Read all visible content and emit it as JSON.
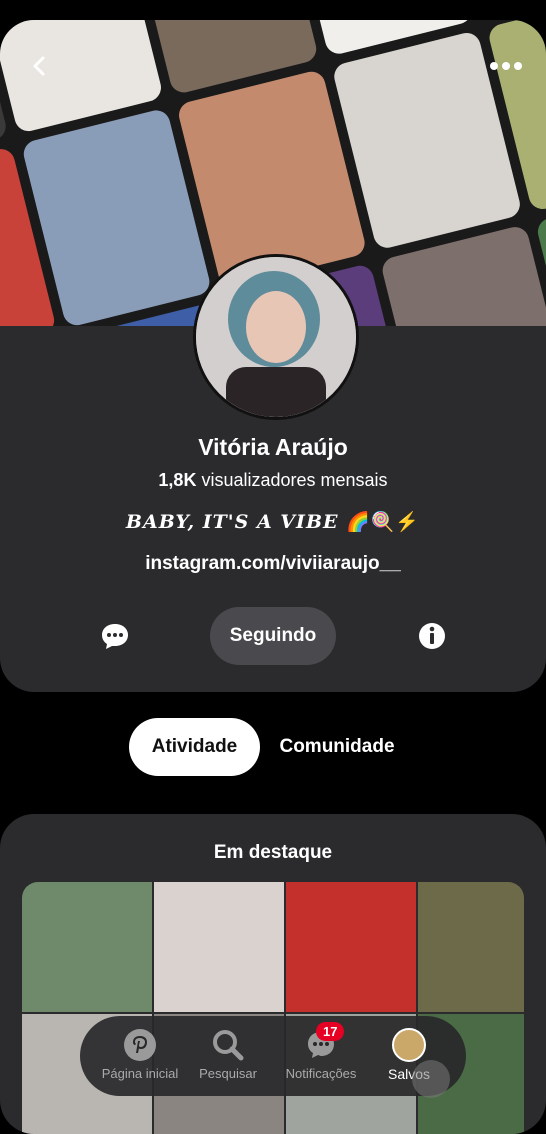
{
  "profile": {
    "name": "Vitória Araújo",
    "viewers_count": "1,8K",
    "viewers_label": "visualizadores mensais",
    "bio": "BABY, IT'S A VIBE",
    "bio_emojis": "🌈🍭⚡",
    "link": "instagram.com/viviiaraujo__",
    "follow_label": "Seguindo"
  },
  "tabs": {
    "active": "Atividade",
    "other": "Comunidade"
  },
  "featured": {
    "title": "Em destaque"
  },
  "nav": {
    "home": "Página inicial",
    "search": "Pesquisar",
    "notifications": "Notificações",
    "notifications_badge": "17",
    "saved": "Salvos"
  },
  "colors": {
    "card_bg": "#2b2a2d",
    "badge": "#e60023",
    "page_bg": "#000000"
  }
}
